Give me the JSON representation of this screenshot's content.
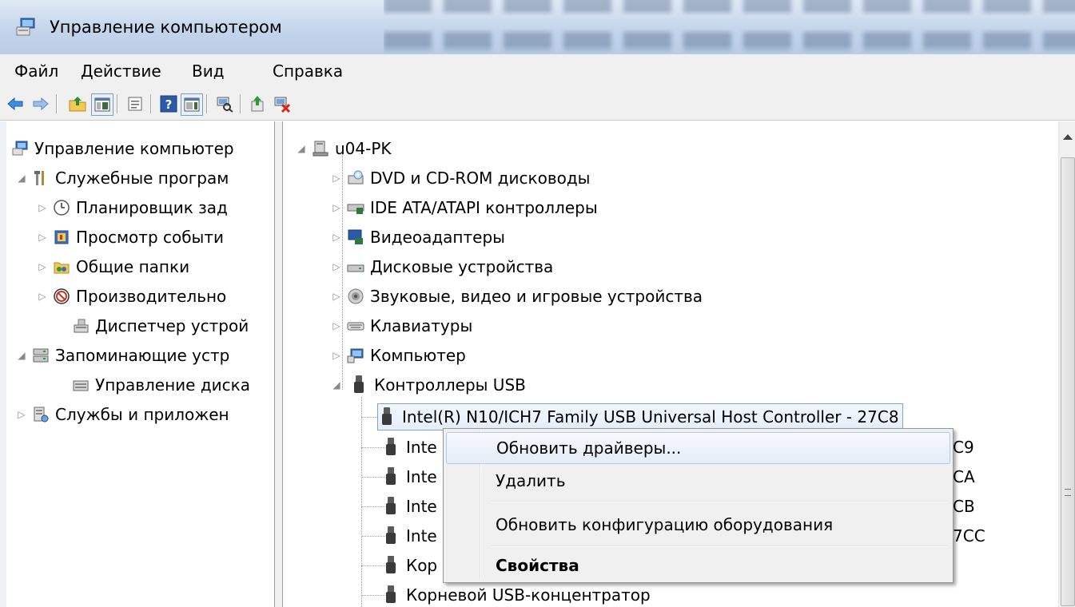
{
  "window": {
    "title": "Управление компьютером"
  },
  "menu": {
    "items": [
      "Файл",
      "Действие",
      "Вид",
      "Справка"
    ]
  },
  "toolbar": {
    "icons": [
      "back-arrow-icon",
      "forward-arrow-icon",
      "up-folder-icon",
      "show-hide-tree-icon",
      "properties-icon",
      "help-icon",
      "show-hide-action-pane-icon",
      "scan-hardware-icon",
      "update-driver-icon",
      "uninstall-device-icon"
    ]
  },
  "left_tree": {
    "items": [
      "Управление компьютер",
      "Служебные програм",
      "Планировщик зад",
      "Просмотр событи",
      "Общие папки",
      "Производительно",
      "Диспетчер устрой",
      "Запоминающие устр",
      "Управление диска",
      "Службы и приложен"
    ]
  },
  "device_tree": {
    "root": "u04-PK",
    "categories": [
      "DVD и CD-ROM дисководы",
      "IDE ATA/ATAPI контроллеры",
      "Видеоадаптеры",
      "Дисковые устройства",
      "Звуковые, видео и игровые устройства",
      "Клавиатуры",
      "Компьютер",
      "Контроллеры USB"
    ],
    "usb_devices": [
      "Intel(R) N10/ICH7 Family USB Universal Host Controller - 27C8",
      "Inte",
      "Inte",
      "Inte",
      "Inte",
      "Кор",
      "Корневой USB-концентратор"
    ],
    "usb_suffixes": [
      "C9",
      "CA",
      "CB",
      "7CC"
    ]
  },
  "context_menu": {
    "items": [
      "Обновить драйверы...",
      "Удалить",
      "Обновить конфигурацию оборудования",
      "Свойства"
    ]
  },
  "colors": {
    "titlebar": "#c4d5eb",
    "selection_border": "#7da2ce",
    "menu_hover_border": "#aeccf1"
  }
}
